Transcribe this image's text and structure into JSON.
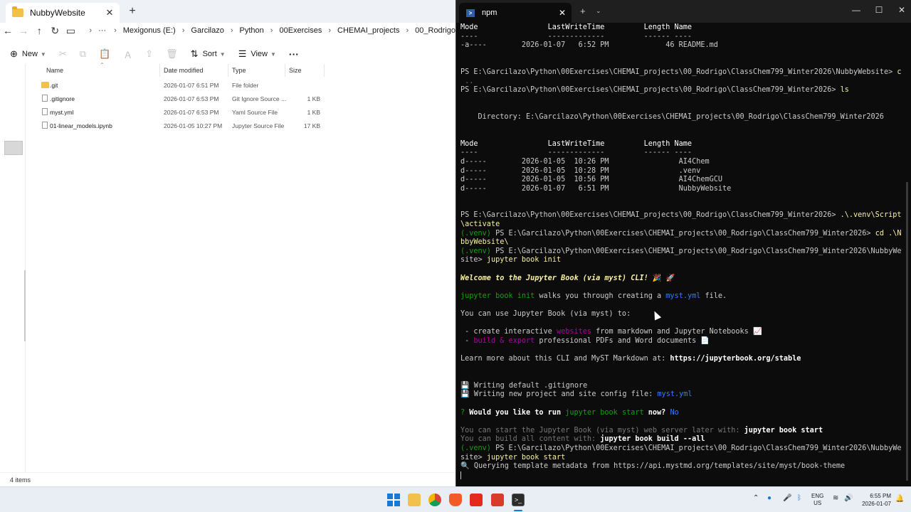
{
  "explorer": {
    "tab_title": "NubbyWebsite",
    "breadcrumbs": [
      "Mexigonus (E:)",
      "Garcilazo",
      "Python",
      "00Exercises",
      "CHEMAI_projects",
      "00_Rodrigo"
    ],
    "toolbar": {
      "new_label": "New",
      "sort_label": "Sort",
      "view_label": "View",
      "more_label": "···"
    },
    "columns": {
      "name": "Name",
      "date": "Date modified",
      "type": "Type",
      "size": "Size"
    },
    "files": [
      {
        "name": ".git",
        "date": "2026-01-07 6:51 PM",
        "type": "File folder",
        "size": "",
        "icon": "folder-icon"
      },
      {
        "name": ".gitignore",
        "date": "2026-01-07 6:53 PM",
        "type": "Git Ignore Source ...",
        "size": "1 KB",
        "icon": "file-icon"
      },
      {
        "name": "myst.yml",
        "date": "2026-01-07 6:53 PM",
        "type": "Yaml Source File",
        "size": "1 KB",
        "icon": "file-icon"
      },
      {
        "name": "01-linear_models.ipynb",
        "date": "2026-01-05 10:27 PM",
        "type": "Jupyter Source File",
        "size": "17 KB",
        "icon": "file-icon"
      }
    ],
    "status": "4 items"
  },
  "terminal": {
    "tab_title": "npm",
    "lines": [
      [
        {
          "t": "Mode                LastWriteTime         Length Name",
          "c": "c-w"
        }
      ],
      [
        {
          "t": "----                -------------         ------ ----",
          "c": ""
        }
      ],
      [
        {
          "t": "-a----        2026-01-07   6:52 PM             46 README.md",
          "c": ""
        }
      ],
      [
        {
          "t": "",
          "c": ""
        }
      ],
      [
        {
          "t": "",
          "c": ""
        }
      ],
      [
        {
          "t": "PS E:\\Garcilazo\\Python\\00Exercises\\CHEMAI_projects\\00_Rodrigo\\ClassChem799_Winter2026\\NubbyWebsite> ",
          "c": ""
        },
        {
          "t": "cd",
          "c": "c-y"
        }
      ],
      [
        {
          "t": " ..",
          "c": "c-gr"
        }
      ],
      [
        {
          "t": "PS E:\\Garcilazo\\Python\\00Exercises\\CHEMAI_projects\\00_Rodrigo\\ClassChem799_Winter2026> ",
          "c": ""
        },
        {
          "t": "ls",
          "c": "c-y"
        }
      ],
      [
        {
          "t": "",
          "c": ""
        }
      ],
      [
        {
          "t": "",
          "c": ""
        }
      ],
      [
        {
          "t": "    Directory: E:\\Garcilazo\\Python\\00Exercises\\CHEMAI_projects\\00_Rodrigo\\ClassChem799_Winter2026",
          "c": ""
        }
      ],
      [
        {
          "t": "",
          "c": ""
        }
      ],
      [
        {
          "t": "",
          "c": ""
        }
      ],
      [
        {
          "t": "Mode                LastWriteTime         Length Name",
          "c": "c-w"
        }
      ],
      [
        {
          "t": "----                -------------         ------ ----",
          "c": ""
        }
      ],
      [
        {
          "t": "d-----        2026-01-05  10:26 PM                AI4Chem",
          "c": ""
        }
      ],
      [
        {
          "t": "d-----        2026-01-05  10:28 PM                .venv",
          "c": ""
        }
      ],
      [
        {
          "t": "d-----        2026-01-05  10:56 PM                AI4ChemGCU",
          "c": ""
        }
      ],
      [
        {
          "t": "d-----        2026-01-07   6:51 PM                NubbyWebsite",
          "c": ""
        }
      ],
      [
        {
          "t": "",
          "c": ""
        }
      ],
      [
        {
          "t": "",
          "c": ""
        }
      ],
      [
        {
          "t": "PS E:\\Garcilazo\\Python\\00Exercises\\CHEMAI_projects\\00_Rodrigo\\ClassChem799_Winter2026> ",
          "c": ""
        },
        {
          "t": ".\\.venv\\Scripts",
          "c": "c-y"
        }
      ],
      [
        {
          "t": "\\activate",
          "c": "c-y"
        }
      ],
      [
        {
          "t": "(.venv) ",
          "c": "c-g"
        },
        {
          "t": "PS E:\\Garcilazo\\Python\\00Exercises\\CHEMAI_projects\\00_Rodrigo\\ClassChem799_Winter2026> ",
          "c": ""
        },
        {
          "t": "cd .\\Nu",
          "c": "c-y"
        }
      ],
      [
        {
          "t": "bbyWebsite\\",
          "c": "c-y"
        }
      ],
      [
        {
          "t": "(.venv) ",
          "c": "c-g"
        },
        {
          "t": "PS E:\\Garcilazo\\Python\\00Exercises\\CHEMAI_projects\\00_Rodrigo\\ClassChem799_Winter2026\\NubbyWeb",
          "c": ""
        }
      ],
      [
        {
          "t": "site> ",
          "c": ""
        },
        {
          "t": "jupyter book init",
          "c": "c-y"
        }
      ],
      [
        {
          "t": "",
          "c": ""
        }
      ],
      [
        {
          "t": "Welcome to the Jupyter Book (via myst) CLI!",
          "c": "c-ital"
        },
        {
          "t": " 🎉 🚀",
          "c": ""
        }
      ],
      [
        {
          "t": "",
          "c": ""
        }
      ],
      [
        {
          "t": "jupyter book init",
          "c": "c-g"
        },
        {
          "t": " walks you through creating a ",
          "c": ""
        },
        {
          "t": "myst.yml",
          "c": "c-b"
        },
        {
          "t": " file.",
          "c": ""
        }
      ],
      [
        {
          "t": "",
          "c": ""
        }
      ],
      [
        {
          "t": "You can use Jupyter Book (via myst) to:",
          "c": ""
        }
      ],
      [
        {
          "t": "",
          "c": ""
        }
      ],
      [
        {
          "t": " - create interactive ",
          "c": ""
        },
        {
          "t": "websites",
          "c": "c-m"
        },
        {
          "t": " from markdown and Jupyter Notebooks 📈",
          "c": ""
        }
      ],
      [
        {
          "t": " - ",
          "c": ""
        },
        {
          "t": "build & export",
          "c": "c-m"
        },
        {
          "t": " professional PDFs and Word documents 📄",
          "c": ""
        }
      ],
      [
        {
          "t": "",
          "c": ""
        }
      ],
      [
        {
          "t": "Learn more about this CLI and MyST Markdown at: ",
          "c": ""
        },
        {
          "t": "https://jupyterbook.org/stable",
          "c": "c-wb"
        }
      ],
      [
        {
          "t": "",
          "c": ""
        }
      ],
      [
        {
          "t": "",
          "c": ""
        }
      ],
      [
        {
          "t": "💾 Writing default .gitignore",
          "c": ""
        }
      ],
      [
        {
          "t": "💾 Writing new project and site config file: ",
          "c": ""
        },
        {
          "t": "myst.yml",
          "c": "c-b"
        }
      ],
      [
        {
          "t": "",
          "c": ""
        }
      ],
      [
        {
          "t": "? ",
          "c": "c-g"
        },
        {
          "t": "Would you like to run ",
          "c": "c-wb"
        },
        {
          "t": "jupyter book start",
          "c": "c-g"
        },
        {
          "t": " now? ",
          "c": "c-wb"
        },
        {
          "t": "No",
          "c": "c-b"
        }
      ],
      [
        {
          "t": "",
          "c": ""
        }
      ],
      [
        {
          "t": "You can start the Jupyter Book (via myst) web server later with: ",
          "c": "c-gr"
        },
        {
          "t": "jupyter book start",
          "c": "c-wb"
        }
      ],
      [
        {
          "t": "You can build all content with: ",
          "c": "c-gr"
        },
        {
          "t": "jupyter book build --all",
          "c": "c-wb"
        }
      ],
      [
        {
          "t": "(.venv) ",
          "c": "c-g"
        },
        {
          "t": "PS E:\\Garcilazo\\Python\\00Exercises\\CHEMAI_projects\\00_Rodrigo\\ClassChem799_Winter2026\\NubbyWeb",
          "c": ""
        }
      ],
      [
        {
          "t": "site> ",
          "c": ""
        },
        {
          "t": "jupyter book start",
          "c": "c-y"
        }
      ],
      [
        {
          "t": "🔍 Querying template metadata from https://api.mystmd.org/templates/site/myst/book-theme",
          "c": ""
        }
      ]
    ]
  },
  "taskbar": {
    "apps": [
      "start-button",
      "file-explorer",
      "chrome",
      "brave",
      "pdf-reader",
      "app",
      "terminal"
    ],
    "tray": {
      "lang_top": "ENG",
      "lang_bottom": "US",
      "time": "6:55 PM",
      "date": "2026-01-07"
    }
  }
}
